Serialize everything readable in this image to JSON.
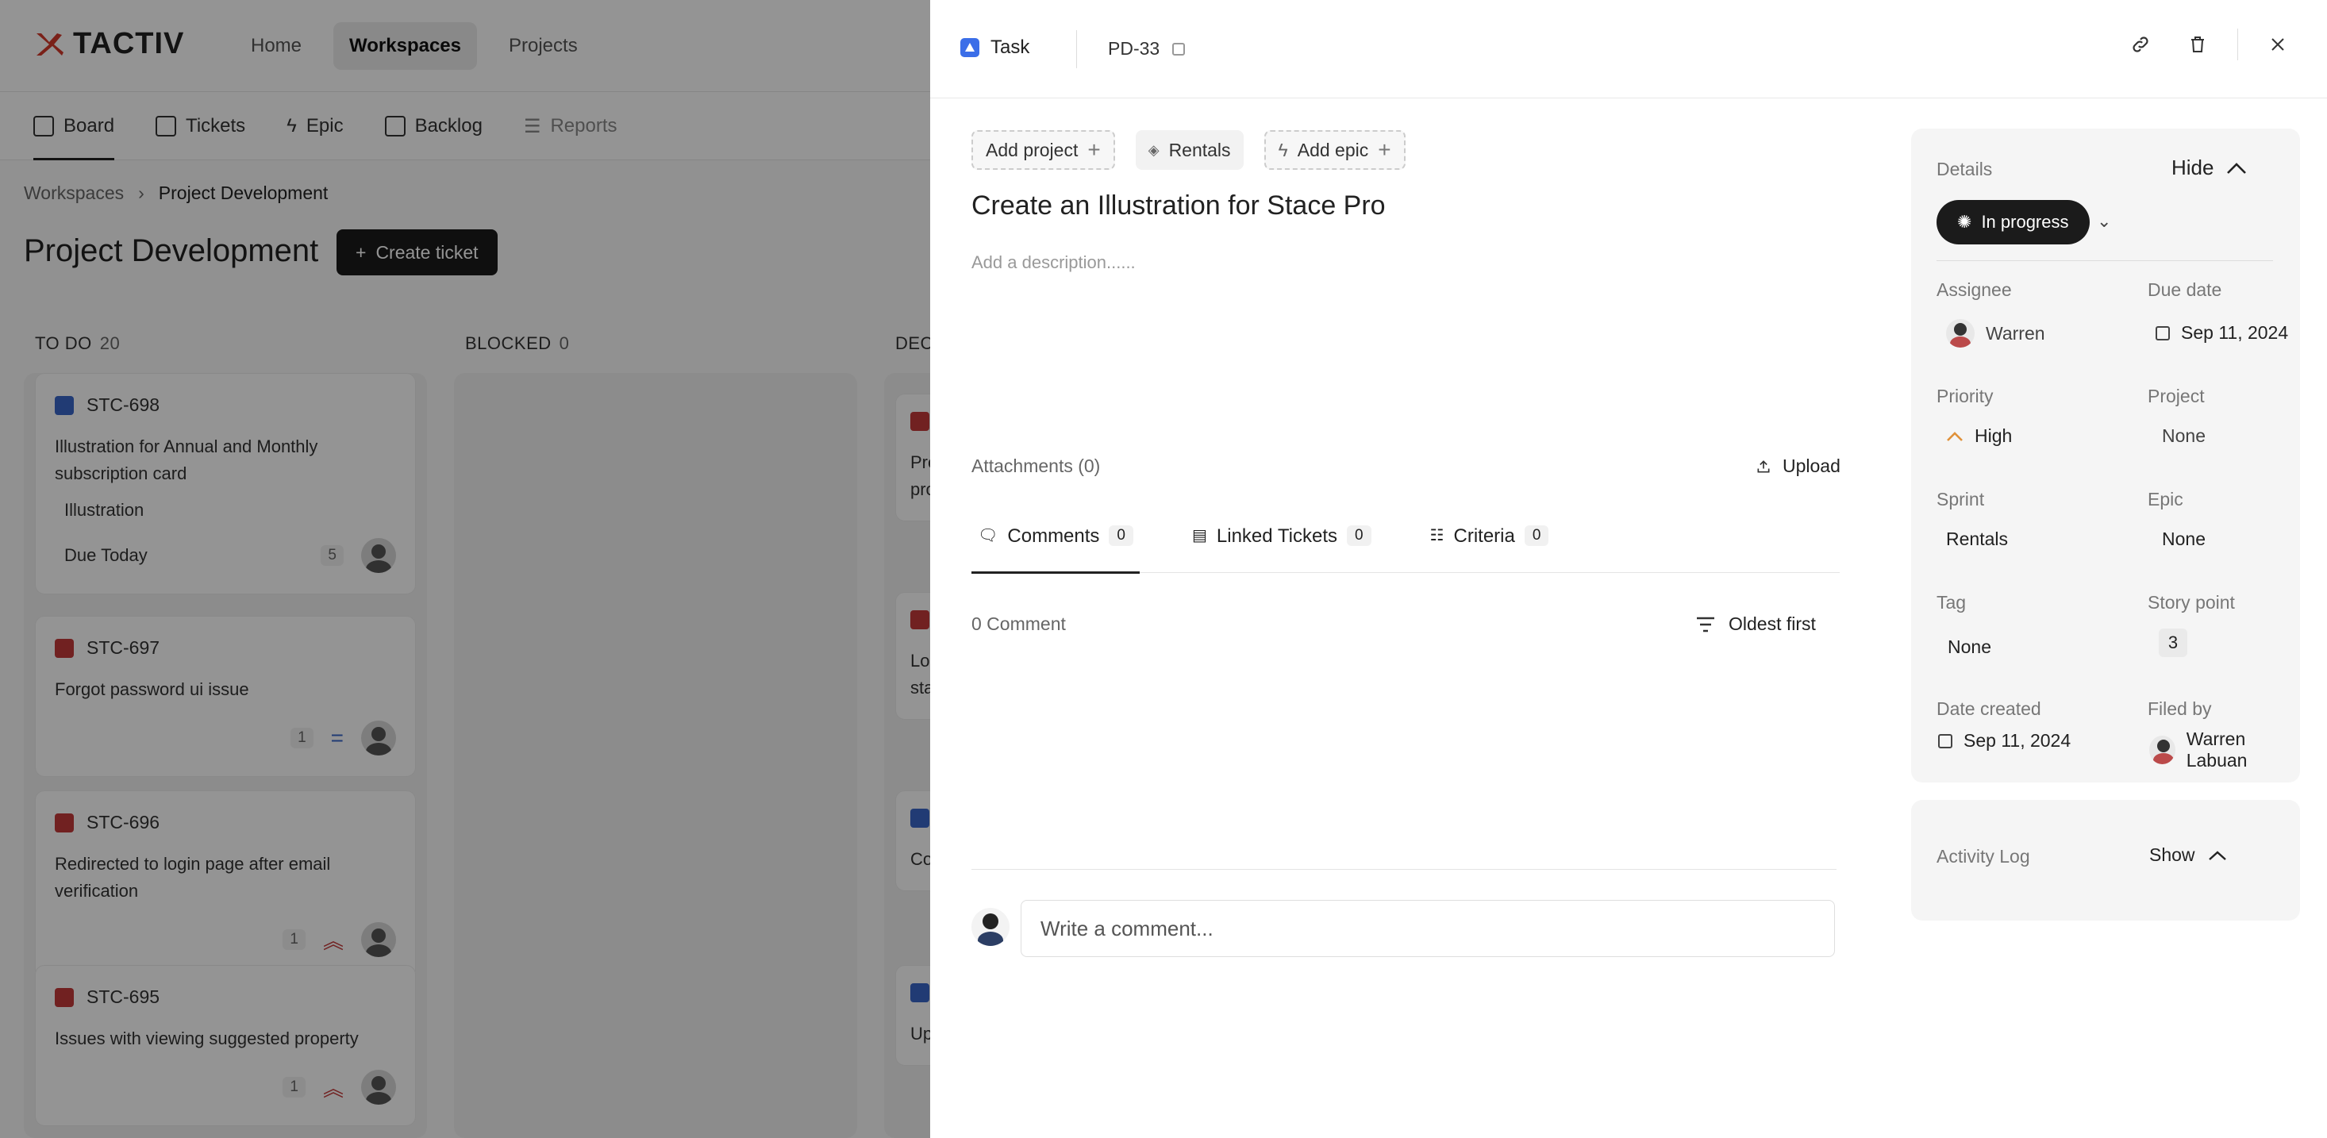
{
  "background": {
    "logo_text": "TACTIV",
    "nav": [
      "Home",
      "Workspaces",
      "Projects"
    ],
    "subtabs": [
      "Board",
      "Tickets",
      "Epic",
      "Backlog",
      "Reports"
    ],
    "breadcrumb": {
      "root": "Workspaces",
      "current": "Project Development"
    },
    "page_title": "Project Development",
    "create_label": "Create ticket",
    "columns": [
      {
        "name": "TO DO",
        "count": "20"
      },
      {
        "name": "BLOCKED",
        "count": "0"
      },
      {
        "name": "DEC",
        "count": ""
      }
    ],
    "cards": [
      {
        "id": "STC-698",
        "title": "Illustration for Annual and Monthly subscription card",
        "tag": "Illustration",
        "due": "Due Today",
        "count": "5",
        "color": "#3a66c9"
      },
      {
        "id": "STC-697",
        "title": "Forgot password ui issue",
        "tag": "",
        "due": "",
        "count": "1",
        "color": "#c33a3a"
      },
      {
        "id": "STC-696",
        "title": "Redirected to login page after email verification",
        "tag": "",
        "due": "",
        "count": "1",
        "color": "#c33a3a"
      },
      {
        "id": "STC-695",
        "title": "Issues with viewing suggested property",
        "tag": "",
        "due": "",
        "count": "1",
        "color": "#c33a3a"
      }
    ],
    "peek_texts": [
      "Pre",
      "pro",
      "Lo",
      "sta",
      "Co",
      "Up"
    ]
  },
  "drawer": {
    "type_label": "Task",
    "ticket_key": "PD-33",
    "chips": {
      "add_project": "Add project",
      "sprint": "Rentals",
      "add_epic": "Add epic"
    },
    "title": "Create an Illustration for Stace Pro",
    "description_placeholder": "Add a description......",
    "attachments_label": "Attachments (0)",
    "upload_label": "Upload",
    "tabs": [
      {
        "label": "Comments",
        "count": "0"
      },
      {
        "label": "Linked Tickets",
        "count": "0"
      },
      {
        "label": "Criteria",
        "count": "0"
      }
    ],
    "comment_count": "0 Comment",
    "sort_label": "Oldest first",
    "comment_placeholder": "Write a comment..."
  },
  "details": {
    "heading": "Details",
    "hide_label": "Hide",
    "status": "In progress",
    "assignee_label": "Assignee",
    "assignee": "Warren",
    "due_label": "Due date",
    "due": "Sep 11, 2024",
    "priority_label": "Priority",
    "priority": "High",
    "project_label": "Project",
    "project": "None",
    "sprint_label": "Sprint",
    "sprint": "Rentals",
    "epic_label": "Epic",
    "epic": "None",
    "tag_label": "Tag",
    "tag": "None",
    "story_label": "Story point",
    "story": "3",
    "created_label": "Date created",
    "created": "Sep 11, 2024",
    "filed_label": "Filed by",
    "filed": "Warren Labuan"
  },
  "activity": {
    "label": "Activity Log",
    "show_label": "Show"
  },
  "colors": {
    "accent": "#1b1b1b",
    "task_icon": "#3b6ee8",
    "priority_high": "#e0913a",
    "urgent": "#c33a3a"
  }
}
